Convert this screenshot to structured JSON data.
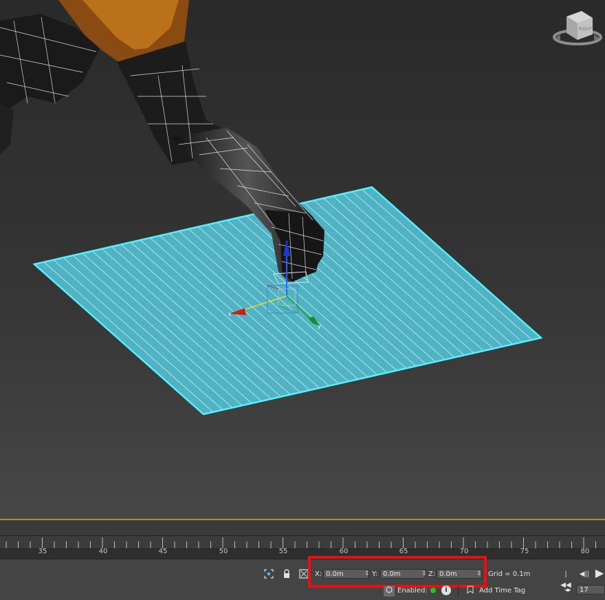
{
  "timeline": {
    "ticks": [
      "35",
      "40",
      "45",
      "50",
      "55",
      "60",
      "65",
      "70",
      "75",
      "80"
    ]
  },
  "statusbar": {
    "coords": {
      "x_label": "X:",
      "x_value": "0.0m",
      "y_label": "Y:",
      "y_value": "0.0m",
      "z_label": "Z:",
      "z_value": "0.0m"
    },
    "grid": "Grid = 0.1m",
    "enabled_label": "Enabled:",
    "add_time_tag": "Add Time Tag",
    "current_frame": "17"
  },
  "icons": {
    "selection_lock": "lock-icon",
    "isolate": "isolate-selection-icon",
    "transform_mode": "absolute-mode-transform-icon",
    "viewcube": "viewcube-icon"
  },
  "colors": {
    "plane": "#4fb3c3",
    "plane_edge": "#54f2ff",
    "highlight": "#e8110f",
    "timeline_accent": "#b98a27"
  }
}
